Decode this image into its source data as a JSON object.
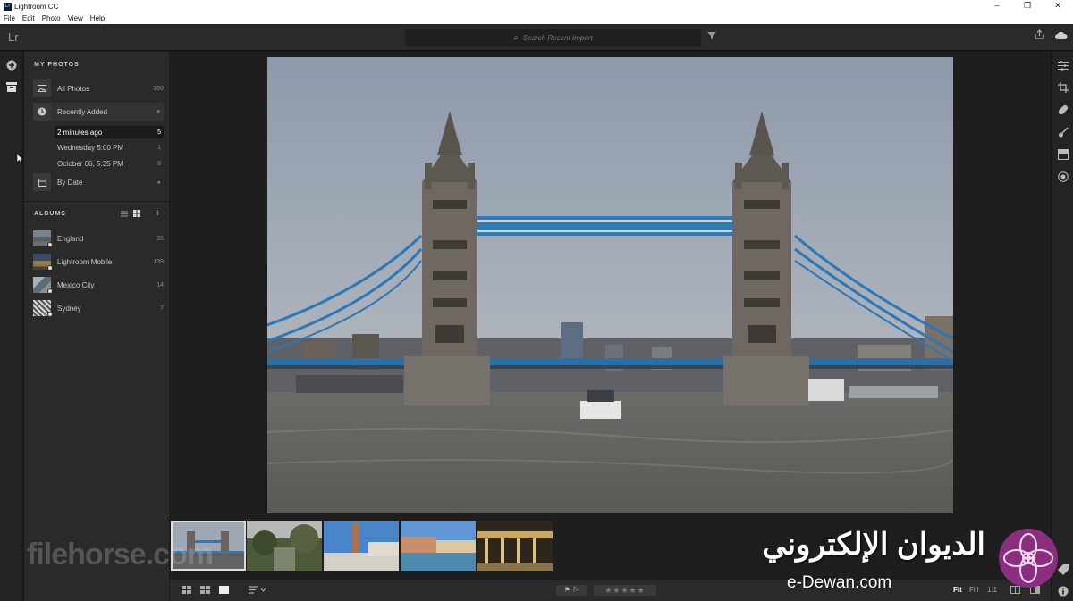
{
  "window": {
    "title": "Lightroom CC",
    "app_badge": "Lr",
    "controls": [
      "–",
      "❐",
      "✕"
    ]
  },
  "menu": [
    "File",
    "Edit",
    "Photo",
    "View",
    "Help"
  ],
  "toolbar": {
    "logo": "Lr",
    "search_placeholder": "Search Recent Import"
  },
  "my_photos": {
    "heading": "MY PHOTOS",
    "all_photos": {
      "label": "All Photos",
      "count": "300"
    },
    "recently_added": {
      "label": "Recently Added",
      "caret": "▾"
    },
    "recent_items": [
      {
        "label": "2 minutes ago",
        "count": "5",
        "selected": true
      },
      {
        "label": "Wednesday  5:00 PM",
        "count": "1",
        "selected": false
      },
      {
        "label": "October 06, 5:35 PM",
        "count": "8",
        "selected": false
      }
    ],
    "by_date": {
      "label": "By Date",
      "caret": "◂"
    }
  },
  "albums": {
    "heading": "ALBUMS",
    "add": "+",
    "items": [
      {
        "label": "England",
        "count": "36"
      },
      {
        "label": "Lightroom Mobile",
        "count": "139"
      },
      {
        "label": "Mexico City",
        "count": "14"
      },
      {
        "label": "Sydney",
        "count": "7"
      }
    ]
  },
  "bottom_bar": {
    "fit": "Fit",
    "fill": "Fill",
    "one_to_one": "1:1",
    "stars": "★★★★★",
    "flags": "⚑ ⚐"
  },
  "watermarks": {
    "left": "filehorse.com",
    "right_arabic": "الديوان الإلكتروني",
    "right_english": "e-Dewan.com"
  }
}
